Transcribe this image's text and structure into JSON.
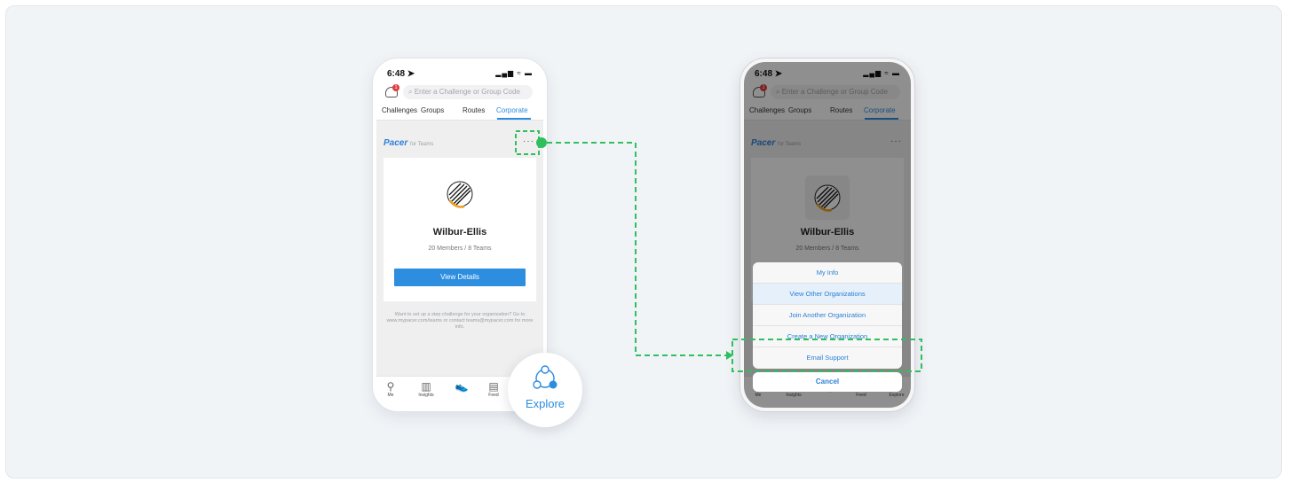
{
  "left_phone": {
    "status": {
      "time": "6:48 ➤",
      "icons": "▂▄▆ ≈ ▬"
    },
    "notification_badge": "1",
    "search": {
      "placeholder": "Enter a Challenge or Group Code"
    },
    "tabs": [
      {
        "label": "Challenges",
        "active": false
      },
      {
        "label": "Groups",
        "active": false
      },
      {
        "label": "Routes",
        "active": false
      },
      {
        "label": "Corporate",
        "active": true
      }
    ],
    "brand": {
      "name": "Pacer",
      "suffix": "for Teams"
    },
    "more_glyph": "···",
    "org": {
      "name": "Wilbur-Ellis",
      "meta": "20 Members / 8 Teams",
      "button": "View Details"
    },
    "info_text": "Want to set up a step challenge for your organization? Go to www.mypacer.com/teams or contact teams@mypacer.com for more info.",
    "nav": [
      {
        "label": "Me",
        "icon": "person-icon"
      },
      {
        "label": "Insights",
        "icon": "bar-chart-icon"
      },
      {
        "label": "",
        "icon": "shoe-icon"
      },
      {
        "label": "Feed",
        "icon": "feed-icon"
      }
    ]
  },
  "explore": {
    "label": "Explore",
    "icon": "explore-network-icon"
  },
  "right_phone": {
    "status": {
      "time": "6:48 ➤",
      "icons": "▂▄▆ ≈ ▬"
    },
    "search": {
      "placeholder": "Enter a Challenge or Group Code"
    },
    "tabs": [
      {
        "label": "Challenges"
      },
      {
        "label": "Groups"
      },
      {
        "label": "Routes"
      },
      {
        "label": "Corporate"
      }
    ],
    "brand": {
      "name": "Pacer",
      "suffix": "for Teams"
    },
    "more_glyph": "···",
    "org": {
      "name": "Wilbur-Ellis",
      "meta": "20 Members / 8 Teams"
    },
    "action_sheet": {
      "items": [
        "My Info",
        "View Other Organizations",
        "Join Another Organization",
        "Create a New Organization",
        "Email Support"
      ],
      "highlighted": "View Other Organizations",
      "cancel": "Cancel"
    },
    "nav": [
      "Me",
      "Insights",
      "",
      "Feed",
      "Explore"
    ]
  },
  "colors": {
    "accent": "#2b8ce0",
    "callout": "#2fbf5f",
    "badge": "#e23b3b",
    "background": "#f1f4f7"
  }
}
